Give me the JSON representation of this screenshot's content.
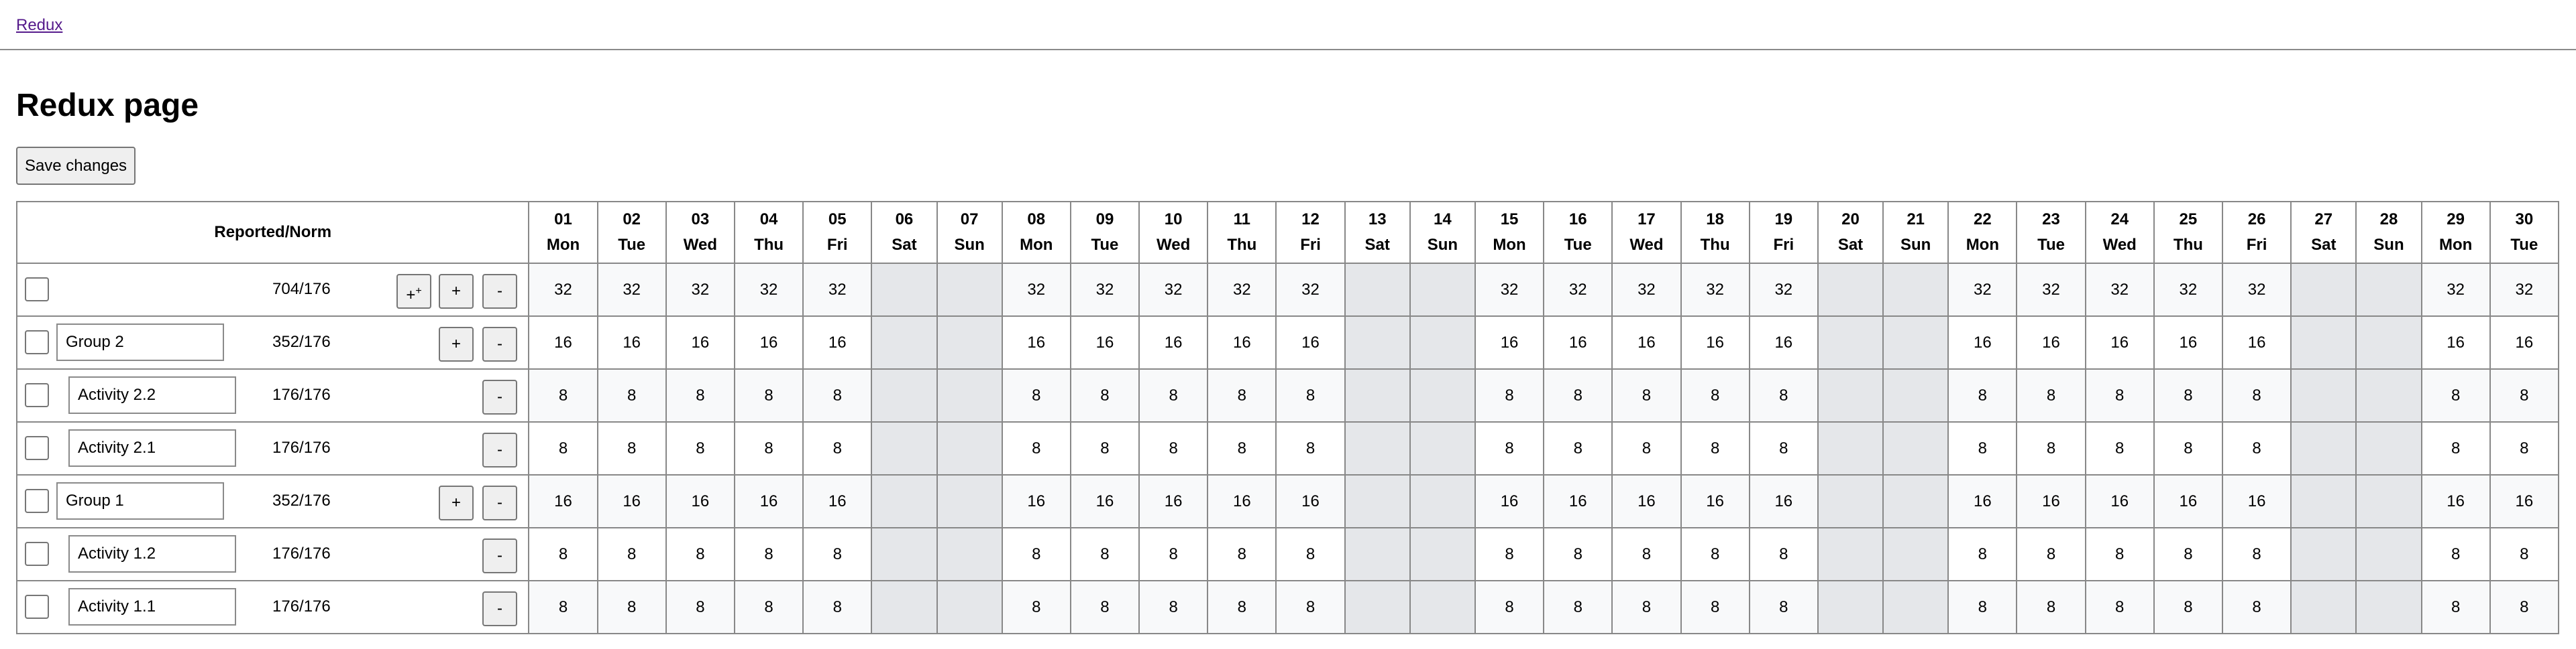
{
  "nav": {
    "link": "Redux"
  },
  "page": {
    "title": "Redux page",
    "save_label": "Save changes"
  },
  "table": {
    "header_label": "Reported/Norm",
    "days": [
      {
        "num": "01",
        "wd": "Mon",
        "weekend": false
      },
      {
        "num": "02",
        "wd": "Tue",
        "weekend": false
      },
      {
        "num": "03",
        "wd": "Wed",
        "weekend": false
      },
      {
        "num": "04",
        "wd": "Thu",
        "weekend": false
      },
      {
        "num": "05",
        "wd": "Fri",
        "weekend": false
      },
      {
        "num": "06",
        "wd": "Sat",
        "weekend": true
      },
      {
        "num": "07",
        "wd": "Sun",
        "weekend": true
      },
      {
        "num": "08",
        "wd": "Mon",
        "weekend": false
      },
      {
        "num": "09",
        "wd": "Tue",
        "weekend": false
      },
      {
        "num": "10",
        "wd": "Wed",
        "weekend": false
      },
      {
        "num": "11",
        "wd": "Thu",
        "weekend": false
      },
      {
        "num": "12",
        "wd": "Fri",
        "weekend": false
      },
      {
        "num": "13",
        "wd": "Sat",
        "weekend": true
      },
      {
        "num": "14",
        "wd": "Sun",
        "weekend": true
      },
      {
        "num": "15",
        "wd": "Mon",
        "weekend": false
      },
      {
        "num": "16",
        "wd": "Tue",
        "weekend": false
      },
      {
        "num": "17",
        "wd": "Wed",
        "weekend": false
      },
      {
        "num": "18",
        "wd": "Thu",
        "weekend": false
      },
      {
        "num": "19",
        "wd": "Fri",
        "weekend": false
      },
      {
        "num": "20",
        "wd": "Sat",
        "weekend": true
      },
      {
        "num": "21",
        "wd": "Sun",
        "weekend": true
      },
      {
        "num": "22",
        "wd": "Mon",
        "weekend": false
      },
      {
        "num": "23",
        "wd": "Tue",
        "weekend": false
      },
      {
        "num": "24",
        "wd": "Wed",
        "weekend": false
      },
      {
        "num": "25",
        "wd": "Thu",
        "weekend": false
      },
      {
        "num": "26",
        "wd": "Fri",
        "weekend": false
      },
      {
        "num": "27",
        "wd": "Sat",
        "weekend": true
      },
      {
        "num": "28",
        "wd": "Sun",
        "weekend": true
      },
      {
        "num": "29",
        "wd": "Mon",
        "weekend": false
      },
      {
        "num": "30",
        "wd": "Tue",
        "weekend": false
      }
    ],
    "rows": [
      {
        "type": "total",
        "name": "",
        "reported": "704/176",
        "value": "32",
        "buttons": [
          "expand",
          "plus",
          "minus"
        ]
      },
      {
        "type": "group",
        "name": "Group 2",
        "reported": "352/176",
        "value": "16",
        "buttons": [
          "plus",
          "minus"
        ]
      },
      {
        "type": "activity",
        "name": "Activity 2.2",
        "reported": "176/176",
        "value": "8",
        "buttons": [
          "minus"
        ]
      },
      {
        "type": "activity",
        "name": "Activity 2.1",
        "reported": "176/176",
        "value": "8",
        "buttons": [
          "minus"
        ]
      },
      {
        "type": "group",
        "name": "Group 1",
        "reported": "352/176",
        "value": "16",
        "buttons": [
          "plus",
          "minus"
        ]
      },
      {
        "type": "activity",
        "name": "Activity 1.2",
        "reported": "176/176",
        "value": "8",
        "buttons": [
          "minus"
        ]
      },
      {
        "type": "activity",
        "name": "Activity 1.1",
        "reported": "176/176",
        "value": "8",
        "buttons": [
          "minus"
        ]
      }
    ],
    "button_labels": {
      "expand": "+",
      "expand_sup": "+",
      "plus": "+",
      "minus": "-"
    }
  }
}
